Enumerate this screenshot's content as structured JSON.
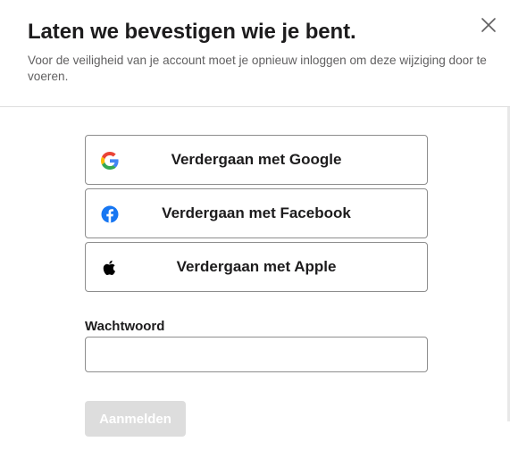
{
  "dialog": {
    "title": "Laten we bevestigen wie je bent.",
    "subtitle": "Voor de veiligheid van je account moet je opnieuw inloggen om deze wijziging door te voeren.",
    "close_icon": "close-icon"
  },
  "sso": {
    "google": {
      "label": "Verdergaan met Google",
      "icon": "google-icon"
    },
    "facebook": {
      "label": "Verdergaan met Facebook",
      "icon": "facebook-icon"
    },
    "apple": {
      "label": "Verdergaan met Apple",
      "icon": "apple-icon"
    }
  },
  "password": {
    "label": "Wachtwoord",
    "value": "",
    "placeholder": ""
  },
  "submit": {
    "label": "Aanmelden",
    "disabled": true
  },
  "colors": {
    "text": "#1d1c1d",
    "muted": "#616061",
    "border": "#8d8d8d",
    "disabled_button": "#dddddd",
    "facebook_blue": "#1877f2"
  }
}
